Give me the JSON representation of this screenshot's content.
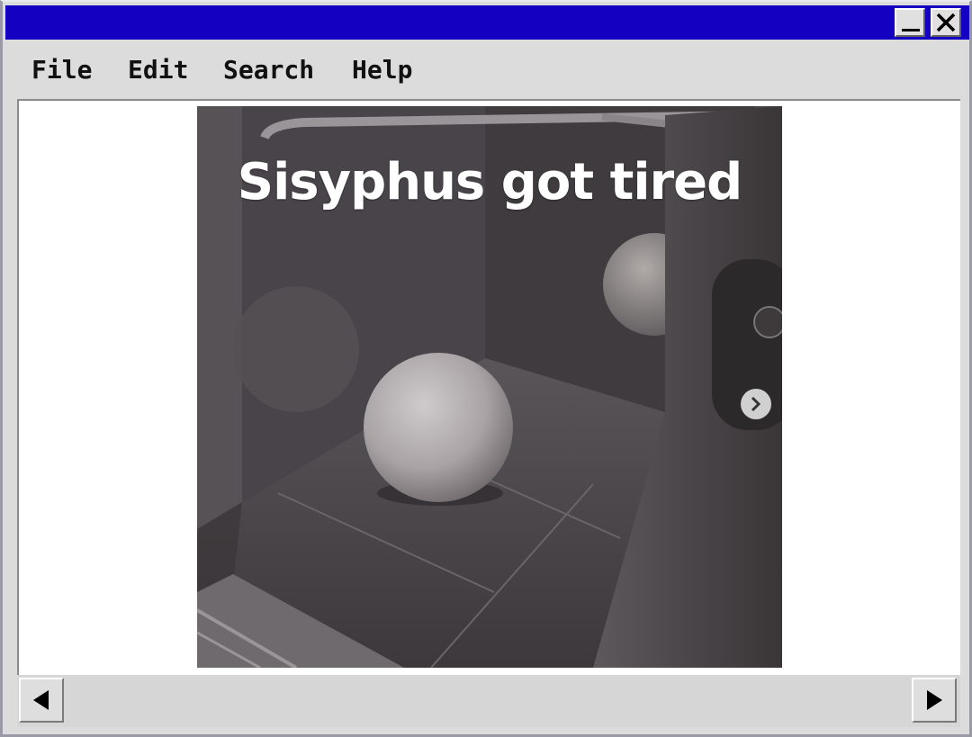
{
  "window": {
    "minimize_icon": "minimize-icon",
    "close_icon": "close-icon",
    "title_color": "#1400c0"
  },
  "menu": {
    "items": [
      "File",
      "Edit",
      "Search",
      "Help"
    ]
  },
  "content": {
    "image_caption": "Sisyphus got tired",
    "next_icon": "chevron-right-icon"
  },
  "scrollbar": {
    "left_icon": "arrow-left-icon",
    "right_icon": "arrow-right-icon"
  }
}
